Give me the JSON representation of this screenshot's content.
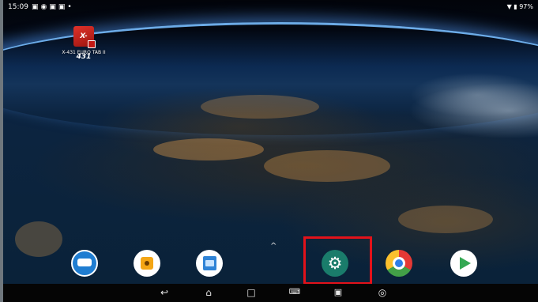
{
  "status_bar": {
    "time": "15:09",
    "battery": "97%",
    "icons": [
      "image-notification-icon",
      "eye-icon",
      "screen-icon",
      "screen-icon",
      "dot-icon",
      "wifi-icon",
      "battery-icon"
    ]
  },
  "desktop": {
    "app_icon_text": "X-431",
    "app_label": "X-431 EURO TAB II"
  },
  "dock": {
    "caret": "^",
    "apps": [
      {
        "name": "remote-diagnosis-app-icon"
      },
      {
        "name": "camera-app-icon"
      },
      {
        "name": "file-manager-app-icon"
      },
      {
        "name": "settings-app-icon",
        "highlighted": true
      },
      {
        "name": "chrome-app-icon"
      },
      {
        "name": "play-store-app-icon"
      }
    ]
  },
  "nav_bar": {
    "buttons": [
      "back-icon",
      "home-icon",
      "recents-icon",
      "keyboard-icon",
      "screenshot-icon",
      "assistant-icon"
    ]
  },
  "colors": {
    "highlight": "#e2121a",
    "settings": "#1a7c6b"
  }
}
